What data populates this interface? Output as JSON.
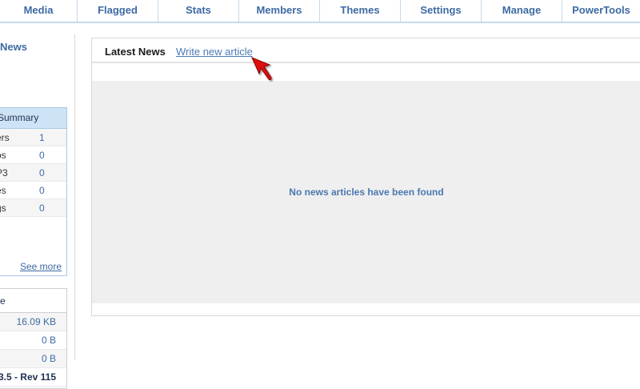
{
  "nav": {
    "tabs": [
      "Media",
      "Flagged",
      "Stats",
      "Members",
      "Themes",
      "Settings",
      "Manage",
      "PowerTools"
    ]
  },
  "sidebar": {
    "news_label": "News",
    "summary": {
      "title": "Summary",
      "rows": [
        {
          "label": "ers",
          "value": "1"
        },
        {
          "label": "os",
          "value": "0"
        },
        {
          "label": "P3",
          "value": "0"
        },
        {
          "label": "es",
          "value": "0"
        },
        {
          "label": "gs",
          "value": "0"
        }
      ],
      "see_more": "See more"
    },
    "info": {
      "title": "e",
      "rows": [
        "16.09 KB",
        "0 B",
        "0 B",
        "3.5 - Rev 115"
      ]
    }
  },
  "main": {
    "title": "Latest News",
    "write_link": "Write new article",
    "empty_message": "No news articles have been found"
  },
  "colors": {
    "accent": "#3d6aa3",
    "pointer": "#e01010"
  }
}
